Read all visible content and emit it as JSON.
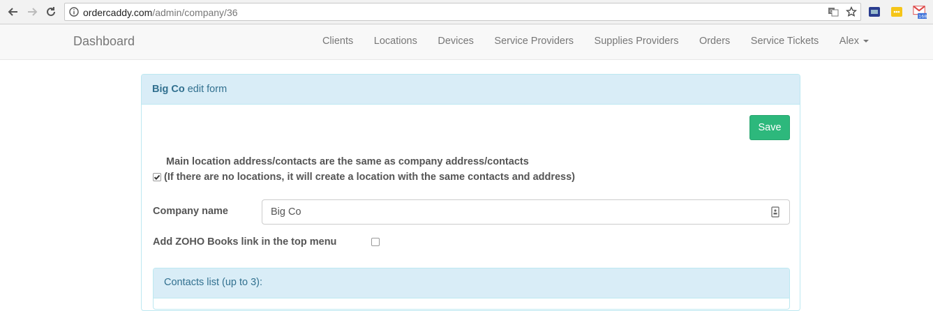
{
  "browser": {
    "url_host": "ordercaddy.com",
    "url_path": "/admin/company/36",
    "gmail_badge": "168"
  },
  "navbar": {
    "brand": "Dashboard",
    "items": [
      "Clients",
      "Locations",
      "Devices",
      "Service Providers",
      "Supplies Providers",
      "Orders",
      "Service Tickets"
    ],
    "user": "Alex"
  },
  "panel": {
    "heading_name": "Big Co",
    "heading_suffix": " edit form",
    "save_label": "Save",
    "main_location_title": "Main location address/contacts are the same as company address/contacts",
    "main_location_note": "(If there are no locations, it will create a location with the same contacts and address)",
    "main_location_checked": true,
    "company_name_label": "Company name",
    "company_name_value": "Big Co",
    "zoho_label": "Add ZOHO Books link in the top menu",
    "zoho_checked": false,
    "contacts_heading": "Contacts list (up to 3):"
  },
  "colors": {
    "save_button": "#2db87c",
    "panel_heading_bg": "#d9edf7",
    "panel_heading_text": "#31708f"
  }
}
